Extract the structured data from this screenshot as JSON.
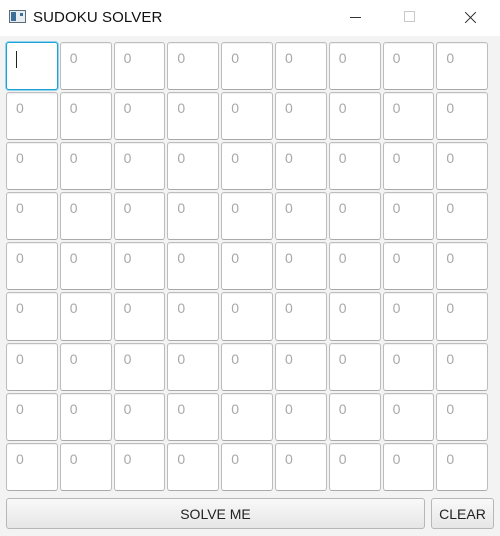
{
  "window": {
    "title": "SUDOKU SOLVER"
  },
  "board": {
    "rows": [
      [
        "",
        "0",
        "0",
        "0",
        "0",
        "0",
        "0",
        "0",
        "0"
      ],
      [
        "0",
        "0",
        "0",
        "0",
        "0",
        "0",
        "0",
        "0",
        "0"
      ],
      [
        "0",
        "0",
        "0",
        "0",
        "0",
        "0",
        "0",
        "0",
        "0"
      ],
      [
        "0",
        "0",
        "0",
        "0",
        "0",
        "0",
        "0",
        "0",
        "0"
      ],
      [
        "0",
        "0",
        "0",
        "0",
        "0",
        "0",
        "0",
        "0",
        "0"
      ],
      [
        "0",
        "0",
        "0",
        "0",
        "0",
        "0",
        "0",
        "0",
        "0"
      ],
      [
        "0",
        "0",
        "0",
        "0",
        "0",
        "0",
        "0",
        "0",
        "0"
      ],
      [
        "0",
        "0",
        "0",
        "0",
        "0",
        "0",
        "0",
        "0",
        "0"
      ],
      [
        "0",
        "0",
        "0",
        "0",
        "0",
        "0",
        "0",
        "0",
        "0"
      ]
    ]
  },
  "buttons": {
    "solve_label": "SOLVE ME",
    "clear_label": "CLEAR"
  },
  "colors": {
    "focus_border": "#1fa3d6",
    "placeholder_text": "#a8a8a8"
  }
}
